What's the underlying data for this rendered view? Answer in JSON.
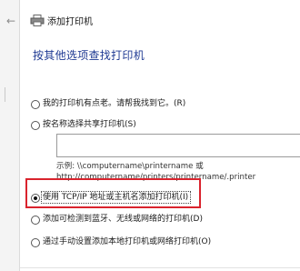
{
  "window": {
    "title": "添加打印机",
    "icon": "printer-icon",
    "back_icon": "back-arrow-icon"
  },
  "page": {
    "heading": "按其他选项查找打印机"
  },
  "options": [
    {
      "id": "not-listed",
      "label": "我的打印机有点老。请帮我找到它。(R)",
      "checked": false
    },
    {
      "id": "select-shared",
      "label": "按名称选择共享打印机(S)",
      "checked": false
    },
    {
      "id": "tcpip",
      "label": "使用 TCP/IP 地址或主机名添加打印机(I)",
      "checked": true
    },
    {
      "id": "bluetooth",
      "label": "添加可检测到蓝牙、无线或网络的打印机(D)",
      "checked": false
    },
    {
      "id": "manual",
      "label": "通过手动设置添加本地打印机或网络打印机(O)",
      "checked": false
    }
  ],
  "shared_printer": {
    "input_value": "",
    "example_line1": "示例: \\\\computername\\printername 或",
    "example_line2": "http://computername/printers/printername/.printer"
  },
  "colors": {
    "heading": "#1f3a93",
    "highlight": "#d9232d"
  }
}
